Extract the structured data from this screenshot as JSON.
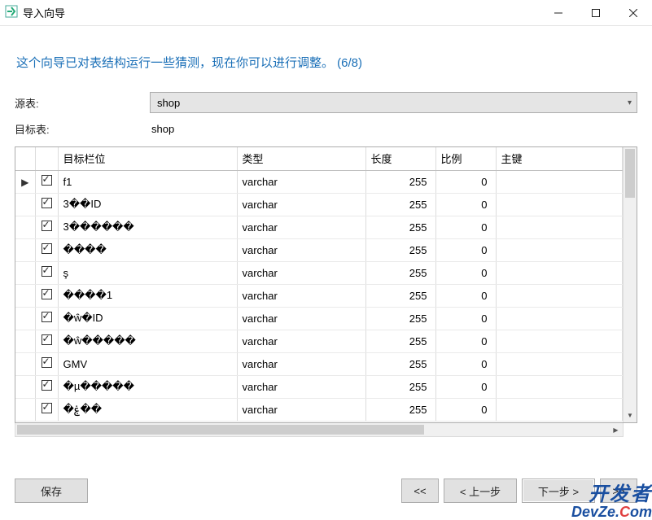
{
  "window": {
    "title": "导入向导"
  },
  "wizard": {
    "headline": "这个向导已对表结构运行一些猜测，现在你可以进行调整。 (6/8)"
  },
  "form": {
    "source_label": "源表:",
    "source_value": "shop",
    "target_label": "目标表:",
    "target_value": "shop"
  },
  "columns": {
    "field": "目标栏位",
    "type": "类型",
    "length": "长度",
    "scale": "比例",
    "pk": "主键"
  },
  "rows": [
    {
      "indicator": "▶",
      "checked": true,
      "field": "f1",
      "type": "varchar",
      "length": "255",
      "scale": "0"
    },
    {
      "indicator": "",
      "checked": true,
      "field": "3��ID",
      "type": "varchar",
      "length": "255",
      "scale": "0"
    },
    {
      "indicator": "",
      "checked": true,
      "field": "3������",
      "type": "varchar",
      "length": "255",
      "scale": "0"
    },
    {
      "indicator": "",
      "checked": true,
      "field": "����",
      "type": "varchar",
      "length": "255",
      "scale": "0"
    },
    {
      "indicator": "",
      "checked": true,
      "field": "ş",
      "type": "varchar",
      "length": "255",
      "scale": "0"
    },
    {
      "indicator": "",
      "checked": true,
      "field": "����1",
      "type": "varchar",
      "length": "255",
      "scale": "0"
    },
    {
      "indicator": "",
      "checked": true,
      "field": "�ŵ�ID",
      "type": "varchar",
      "length": "255",
      "scale": "0"
    },
    {
      "indicator": "",
      "checked": true,
      "field": "�ŵ�����",
      "type": "varchar",
      "length": "255",
      "scale": "0"
    },
    {
      "indicator": "",
      "checked": true,
      "field": "GMV",
      "type": "varchar",
      "length": "255",
      "scale": "0"
    },
    {
      "indicator": "",
      "checked": true,
      "field": "�µ�����",
      "type": "varchar",
      "length": "255",
      "scale": "0"
    },
    {
      "indicator": "",
      "checked": true,
      "field": "�ۼ��",
      "type": "varchar",
      "length": "255",
      "scale": "0"
    }
  ],
  "buttons": {
    "save": "保存",
    "first": "<<",
    "back": "< 上一步",
    "next": "下一步 >",
    "last": ">>"
  },
  "watermark": {
    "line1": "开发者",
    "line2a": "DevZe.",
    "line2b": "C",
    "line2c": "om"
  }
}
